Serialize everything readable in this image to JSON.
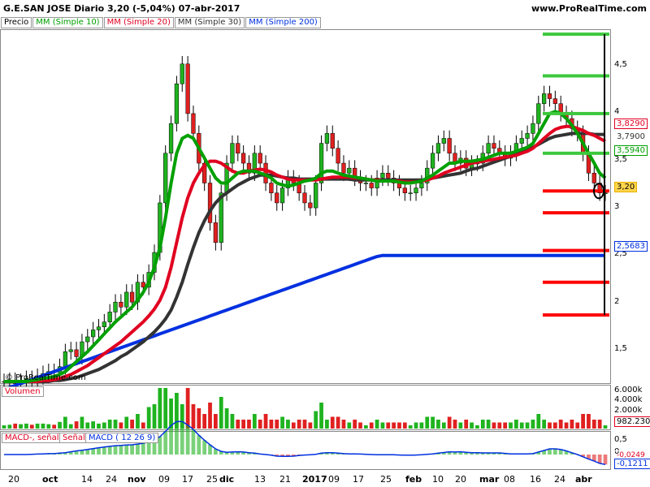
{
  "header": {
    "title": "G.E.SAN JOSE   Diario   3,20 (-5,04%)   07-abr-2017",
    "site": "www.ProRealTime.com"
  },
  "legend": {
    "items": [
      "Precio",
      "MM (Simple 10)",
      "MM (Simple 20)",
      "MM (Simple 30)",
      "MM (Simple 200)"
    ],
    "colors": [
      "#000000",
      "#00a000",
      "#e00020",
      "#333333",
      "#0030e0"
    ]
  },
  "watermark": "© ProRealTime.com",
  "price_axis": {
    "ticks": [
      "4,5",
      "4",
      "3,5",
      "3",
      "2,5",
      "2",
      "1,5"
    ]
  },
  "price_labels": [
    {
      "text": "3,8290",
      "color": "#e00020"
    },
    {
      "text": "3,7900",
      "color": "#333333"
    },
    {
      "text": "3,5940",
      "color": "#00a000"
    },
    {
      "text": "3,20",
      "color": "#e8b000"
    },
    {
      "text": "2,5683",
      "color": "#0030e0"
    }
  ],
  "volume_panel": {
    "tag": "Volumen",
    "ticks": [
      "6.000k",
      "4.000k",
      "2.000k"
    ],
    "last": "982.230"
  },
  "macd_panel": {
    "tags": [
      "MACD-, señal",
      "Señal",
      "MACD ( 12 26 9)"
    ],
    "ticks": [
      "0,5",
      "0"
    ],
    "last1": "-0,0249",
    "last2": "-0,1211"
  },
  "x_axis": {
    "labels": [
      "20",
      "oct",
      "14",
      "24",
      "nov",
      "09",
      "17",
      "25",
      "dic",
      "13",
      "21",
      "2017",
      "09",
      "17",
      "25",
      "feb",
      "10",
      "20",
      "mar",
      "08",
      "16",
      "24",
      "abr"
    ],
    "bold": [
      "oct",
      "nov",
      "dic",
      "2017",
      "feb",
      "mar",
      "abr"
    ]
  },
  "chart_data": {
    "type": "candlestick",
    "title": "G.E.SAN JOSE",
    "ylim": [
      1.3,
      4.85
    ],
    "close": [
      1.3,
      1.31,
      1.28,
      1.3,
      1.33,
      1.32,
      1.35,
      1.38,
      1.4,
      1.39,
      1.45,
      1.6,
      1.62,
      1.55,
      1.7,
      1.75,
      1.82,
      1.85,
      1.9,
      2.0,
      2.1,
      2.05,
      2.2,
      2.1,
      2.3,
      2.25,
      2.4,
      2.6,
      3.1,
      3.6,
      3.9,
      4.3,
      4.5,
      4.0,
      3.8,
      3.5,
      3.3,
      2.9,
      2.7,
      3.2,
      3.5,
      3.7,
      3.6,
      3.5,
      3.4,
      3.6,
      3.5,
      3.3,
      3.2,
      3.1,
      3.25,
      3.35,
      3.3,
      3.2,
      3.1,
      3.05,
      3.3,
      3.7,
      3.8,
      3.65,
      3.5,
      3.4,
      3.45,
      3.35,
      3.3,
      3.3,
      3.25,
      3.35,
      3.4,
      3.35,
      3.3,
      3.25,
      3.2,
      3.2,
      3.25,
      3.3,
      3.45,
      3.6,
      3.7,
      3.75,
      3.6,
      3.5,
      3.55,
      3.45,
      3.5,
      3.5,
      3.6,
      3.7,
      3.65,
      3.6,
      3.55,
      3.6,
      3.7,
      3.75,
      3.8,
      3.9,
      4.1,
      4.2,
      4.15,
      4.1,
      4.0,
      3.95,
      3.85,
      3.8,
      3.6,
      3.4,
      3.3,
      3.2,
      3.2
    ],
    "ma10": [
      1.3,
      1.3,
      1.3,
      1.3,
      1.3,
      1.31,
      1.32,
      1.33,
      1.34,
      1.35,
      1.37,
      1.4,
      1.45,
      1.5,
      1.55,
      1.6,
      1.66,
      1.72,
      1.78,
      1.84,
      1.9,
      1.95,
      2.0,
      2.05,
      2.12,
      2.2,
      2.3,
      2.45,
      2.65,
      2.95,
      3.3,
      3.6,
      3.75,
      3.78,
      3.75,
      3.65,
      3.55,
      3.45,
      3.35,
      3.3,
      3.3,
      3.35,
      3.4,
      3.42,
      3.42,
      3.42,
      3.4,
      3.38,
      3.35,
      3.3,
      3.28,
      3.27,
      3.28,
      3.3,
      3.32,
      3.33,
      3.35,
      3.4,
      3.42,
      3.42,
      3.4,
      3.38,
      3.37,
      3.36,
      3.35,
      3.34,
      3.33,
      3.32,
      3.32,
      3.32,
      3.32,
      3.31,
      3.3,
      3.3,
      3.31,
      3.32,
      3.35,
      3.38,
      3.42,
      3.46,
      3.5,
      3.5,
      3.52,
      3.52,
      3.52,
      3.53,
      3.54,
      3.56,
      3.58,
      3.6,
      3.6,
      3.6,
      3.62,
      3.64,
      3.66,
      3.7,
      3.8,
      3.9,
      4.0,
      4.02,
      4.0,
      3.95,
      3.88,
      3.8,
      3.7,
      3.6,
      3.5,
      3.4,
      3.35
    ],
    "ma20": [
      1.3,
      1.3,
      1.3,
      1.3,
      1.3,
      1.3,
      1.3,
      1.31,
      1.31,
      1.32,
      1.33,
      1.35,
      1.37,
      1.4,
      1.43,
      1.46,
      1.5,
      1.54,
      1.58,
      1.62,
      1.66,
      1.7,
      1.75,
      1.8,
      1.85,
      1.9,
      1.96,
      2.03,
      2.12,
      2.25,
      2.45,
      2.7,
      2.95,
      3.15,
      3.3,
      3.4,
      3.48,
      3.52,
      3.52,
      3.5,
      3.46,
      3.42,
      3.4,
      3.4,
      3.42,
      3.43,
      3.44,
      3.43,
      3.41,
      3.38,
      3.36,
      3.34,
      3.33,
      3.33,
      3.33,
      3.33,
      3.33,
      3.34,
      3.35,
      3.36,
      3.36,
      3.36,
      3.36,
      3.35,
      3.35,
      3.34,
      3.33,
      3.33,
      3.32,
      3.32,
      3.32,
      3.32,
      3.31,
      3.31,
      3.31,
      3.32,
      3.33,
      3.35,
      3.37,
      3.4,
      3.42,
      3.44,
      3.46,
      3.48,
      3.5,
      3.51,
      3.52,
      3.53,
      3.54,
      3.55,
      3.56,
      3.57,
      3.58,
      3.6,
      3.62,
      3.65,
      3.7,
      3.75,
      3.8,
      3.84,
      3.86,
      3.87,
      3.87,
      3.85,
      3.83,
      3.8,
      3.78,
      3.75,
      3.72
    ],
    "ma30": [
      1.3,
      1.3,
      1.3,
      1.3,
      1.3,
      1.3,
      1.3,
      1.3,
      1.3,
      1.31,
      1.31,
      1.32,
      1.33,
      1.34,
      1.36,
      1.38,
      1.4,
      1.42,
      1.45,
      1.48,
      1.51,
      1.55,
      1.58,
      1.62,
      1.66,
      1.7,
      1.75,
      1.8,
      1.86,
      1.93,
      2.02,
      2.15,
      2.3,
      2.48,
      2.65,
      2.8,
      2.92,
      3.02,
      3.1,
      3.16,
      3.2,
      3.24,
      3.28,
      3.31,
      3.34,
      3.36,
      3.38,
      3.38,
      3.38,
      3.37,
      3.36,
      3.35,
      3.35,
      3.34,
      3.34,
      3.34,
      3.34,
      3.34,
      3.34,
      3.34,
      3.34,
      3.34,
      3.34,
      3.33,
      3.33,
      3.33,
      3.33,
      3.33,
      3.33,
      3.33,
      3.33,
      3.33,
      3.33,
      3.33,
      3.33,
      3.33,
      3.34,
      3.35,
      3.36,
      3.37,
      3.38,
      3.39,
      3.4,
      3.42,
      3.44,
      3.45,
      3.47,
      3.49,
      3.51,
      3.53,
      3.55,
      3.57,
      3.59,
      3.61,
      3.63,
      3.66,
      3.69,
      3.72,
      3.75,
      3.77,
      3.78,
      3.79,
      3.8,
      3.8,
      3.8,
      3.8,
      3.79,
      3.79,
      3.79
    ],
    "ma200": [
      1.22,
      1.24,
      1.26,
      1.28,
      1.3,
      1.32,
      1.34,
      1.36,
      1.38,
      1.4,
      1.42,
      1.44,
      1.46,
      1.48,
      1.5,
      1.52,
      1.54,
      1.56,
      1.58,
      1.6,
      1.62,
      1.64,
      1.66,
      1.68,
      1.7,
      1.72,
      1.74,
      1.76,
      1.78,
      1.8,
      1.82,
      1.84,
      1.86,
      1.88,
      1.9,
      1.92,
      1.94,
      1.96,
      1.98,
      2.0,
      2.02,
      2.04,
      2.06,
      2.08,
      2.1,
      2.12,
      2.14,
      2.16,
      2.18,
      2.2,
      2.22,
      2.24,
      2.26,
      2.28,
      2.3,
      2.32,
      2.34,
      2.36,
      2.38,
      2.4,
      2.42,
      2.44,
      2.46,
      2.48,
      2.5,
      2.52,
      2.54,
      2.56,
      2.57,
      2.57,
      2.57,
      2.57,
      2.57,
      2.57,
      2.57,
      2.57,
      2.57,
      2.57,
      2.57,
      2.57,
      2.57,
      2.57,
      2.57,
      2.57,
      2.57,
      2.57,
      2.57,
      2.57,
      2.57,
      2.57,
      2.57,
      2.57,
      2.57,
      2.57,
      2.57,
      2.57,
      2.57,
      2.57,
      2.57,
      2.57,
      2.57,
      2.57,
      2.57,
      2.57,
      2.57,
      2.57,
      2.57,
      2.57,
      2.57
    ],
    "levels_green": [
      4.8,
      4.38,
      4.0,
      3.6
    ],
    "levels_red": [
      3.22,
      3.0,
      2.62,
      2.3,
      1.97
    ]
  }
}
